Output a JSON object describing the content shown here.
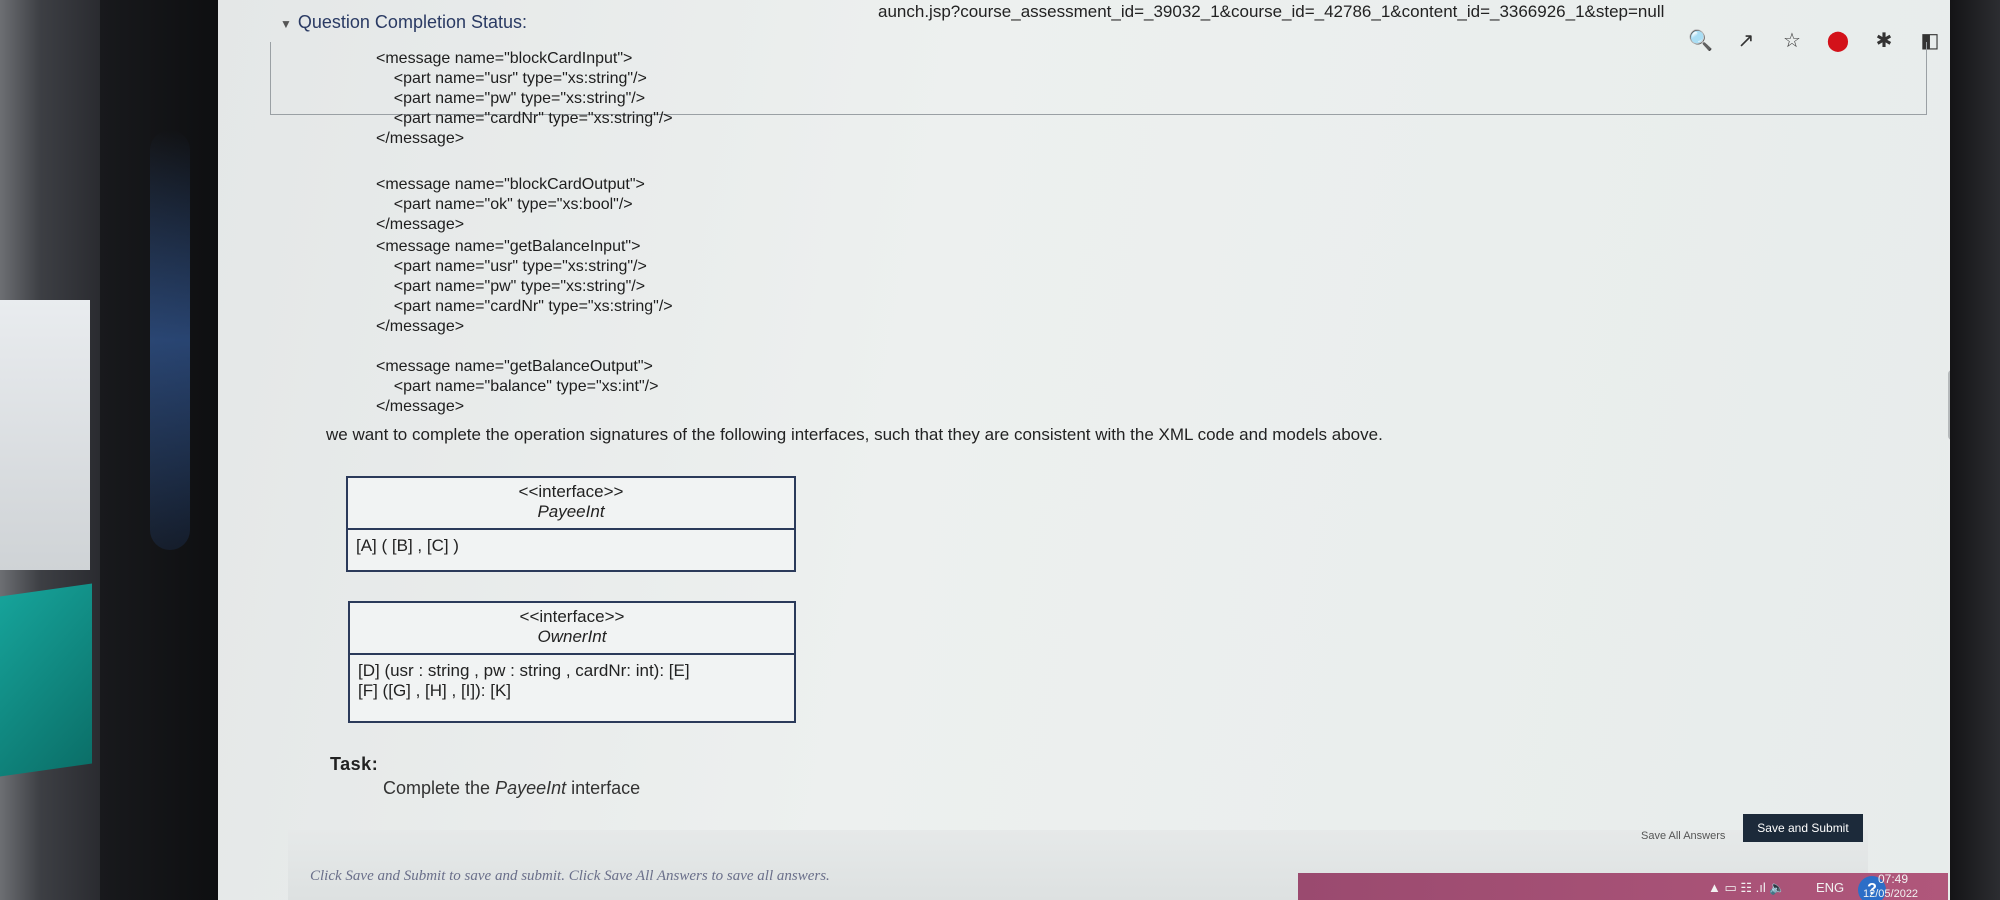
{
  "browser": {
    "url_fragment": "aunch.jsp?course_assessment_id=_39032_1&course_id=_42786_1&content_id=_3366926_1&step=null",
    "icons": [
      "zoom-icon",
      "share-icon",
      "star-icon",
      "extension-red-icon",
      "puzzle-icon",
      "sidebar-icon",
      "profile-icon",
      "menu-dots-icon"
    ]
  },
  "status": {
    "label": "Question Completion Status:"
  },
  "code_lines": [
    "<message name=\"blockCardInput\">",
    "    <part name=\"usr\" type=\"xs:string\"/>",
    "    <part name=\"pw\" type=\"xs:string\"/>",
    "    <part name=\"cardNr\" type=\"xs:string\"/>",
    "</message>",
    "",
    "<message name=\"blockCardOutput\">",
    "    <part name=\"ok\" type=\"xs:bool\"/>",
    "</message>",
    "<message name=\"getBalanceInput\">",
    "    <part name=\"usr\" type=\"xs:string\"/>",
    "    <part name=\"pw\" type=\"xs:string\"/>",
    "    <part name=\"cardNr\" type=\"xs:string\"/>",
    "</message>",
    "",
    "<message name=\"getBalanceOutput\">",
    "    <part name=\"balance\" type=\"xs:int\"/>",
    "</message>"
  ],
  "prompt": "we want to complete the operation signatures of the following interfaces, such that they are consistent with the XML code and models above.",
  "interfaces": [
    {
      "stereotype": "<<interface>>",
      "name": "PayeeInt",
      "ops": [
        "[A] ( [B] , [C] )"
      ]
    },
    {
      "stereotype": "<<interface>>",
      "name": "OwnerInt",
      "ops": [
        "[D] (usr : string , pw : string , cardNr: int): [E]",
        "[F] ([G] , [H] , [I]): [K]"
      ]
    }
  ],
  "task": {
    "label": "Task:",
    "text_prefix": "Complete the ",
    "text_name": "PayeeInt",
    "text_suffix": " interface"
  },
  "footer": {
    "note": "Click Save and Submit to save and submit. Click Save All Answers to save all answers.",
    "save_all_label": "Save All Answers",
    "submit_label": "Save and Submit"
  },
  "system_tray": {
    "language": "ENG",
    "time": "07:49",
    "date": "12/05/2022"
  }
}
